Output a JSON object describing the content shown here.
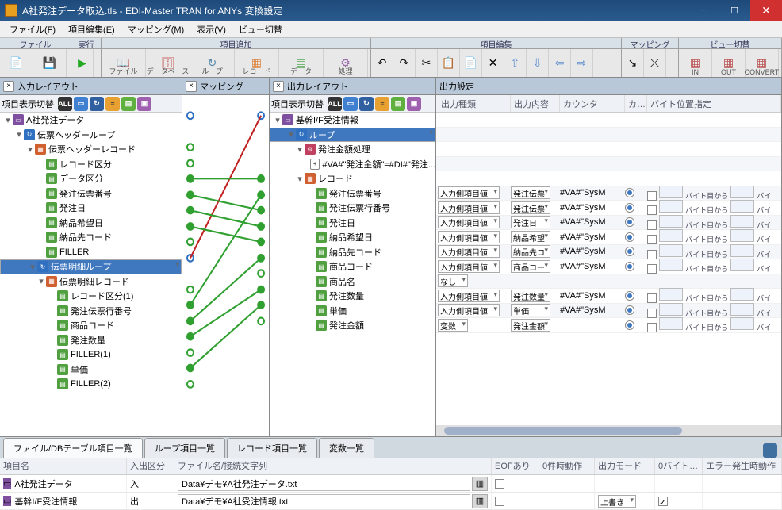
{
  "window": {
    "title": "A社発注データ取込.tls - EDI-Master TRAN for ANYs 変換設定"
  },
  "menu": {
    "file": "ファイル(F)",
    "item_edit": "項目編集(E)",
    "mapping": "マッピング(M)",
    "view": "表示(V)",
    "view_switch": "ビュー切替"
  },
  "ribbon": {
    "groups": {
      "file": "ファイル",
      "run": "実行",
      "item_add": "項目追加",
      "item_edit": "項目編集",
      "mapping": "マッピング",
      "view_switch": "ビュー切替"
    },
    "btns": {
      "file": "ファイル",
      "db": "データベース",
      "loop": "ループ",
      "record": "レコード",
      "data": "データ",
      "proc": "処理",
      "in": "IN",
      "out": "OUT",
      "convert": "CONVERT"
    }
  },
  "panels": {
    "in_layout": "入力レイアウト",
    "mapping": "マッピング",
    "out_layout": "出力レイアウト",
    "out_settings": "出力設定",
    "toggle_label": "項目表示切替",
    "all": "ALL"
  },
  "input_tree": {
    "root": "A社発注データ",
    "nodes": [
      "伝票ヘッダーループ",
      "伝票ヘッダーレコード",
      "レコード区分",
      "データ区分",
      "発注伝票番号",
      "発注日",
      "納品希望日",
      "納品先コード",
      "FILLER",
      "伝票明細ループ",
      "伝票明細レコード",
      "レコード区分(1)",
      "発注伝票行番号",
      "商品コード",
      "発注数量",
      "FILLER(1)",
      "単価",
      "FILLER(2)"
    ]
  },
  "output_tree": {
    "root": "基幹I/F受注情報",
    "loop": "ループ",
    "proc": "発注金額処理",
    "expr": "#VA#\"発注金額\"=#DI#\"発注...",
    "record": "レコード",
    "fields": [
      "発注伝票番号",
      "発注伝票行番号",
      "発注日",
      "納品希望日",
      "納品先コード",
      "商品コード",
      "商品名",
      "発注数量",
      "単価",
      "発注金額"
    ]
  },
  "settings": {
    "cols": {
      "type": "出力種類",
      "content": "出力内容",
      "counter": "カウンタ",
      "ka": "カ…",
      "byte_pos": "バイト位置指定"
    },
    "type_input": "入力側項目値",
    "type_none": "なし",
    "type_var": "変数",
    "contents": [
      "発注伝票",
      "発注伝票",
      "発注日",
      "納品希望",
      "納品先コ",
      "商品コー",
      "",
      "発注数量",
      "単価",
      "発注金額"
    ],
    "counter_val": "#VA#\"SysM",
    "byte_suffix": "バイト目から",
    "byte_suffix2": "バイ"
  },
  "tabs": {
    "file_db": "ファイル/DBテーブル項目一覧",
    "loop": "ループ項目一覧",
    "record": "レコード項目一覧",
    "var": "変数一覧"
  },
  "bottom_grid": {
    "cols": {
      "name": "項目名",
      "io": "入出区分",
      "file": "ファイル名/接続文字列",
      "eof": "EOFあり",
      "zero_action": "0件時動作",
      "out_mode": "出力モード",
      "zero_byte": "0バイト…",
      "error": "エラー発生時動作"
    },
    "rows": [
      {
        "name": "A社発注データ",
        "io": "入",
        "file": "Data¥デモ¥A社発注データ.txt",
        "out_mode": "",
        "zero_byte_checked": false
      },
      {
        "name": "基幹I/F受注情報",
        "io": "出",
        "file": "Data¥デモ¥A社受注情報.txt",
        "out_mode": "上書き",
        "zero_byte_checked": true
      }
    ]
  }
}
